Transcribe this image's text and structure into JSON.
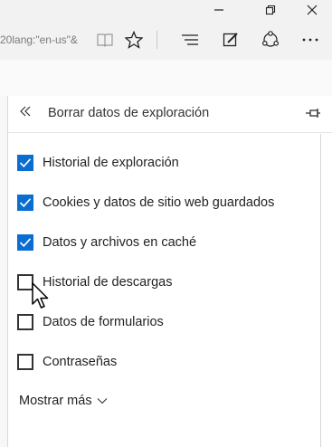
{
  "browser": {
    "url_fragment": "20lang:\"en-us\"&"
  },
  "panel": {
    "title": "Borrar datos de exploración",
    "items": [
      {
        "label": "Historial de exploración",
        "checked": true
      },
      {
        "label": "Cookies y datos de sitio web guardados",
        "checked": true
      },
      {
        "label": "Datos y archivos en caché",
        "checked": true
      },
      {
        "label": "Historial de descargas",
        "checked": false
      },
      {
        "label": "Datos de formularios",
        "checked": false
      },
      {
        "label": "Contraseñas",
        "checked": false
      }
    ],
    "show_more": "Mostrar más"
  },
  "colors": {
    "accent": "#0a6ed1",
    "chrome": "#f2f2f2"
  },
  "icons": [
    "minimize-icon",
    "restore-icon",
    "close-icon",
    "reading-view-icon",
    "favorite-star-icon",
    "hub-icon",
    "web-note-icon",
    "share-icon",
    "more-icon",
    "back-chevrons-icon",
    "pin-icon",
    "chevron-down-icon",
    "mouse-cursor-icon"
  ]
}
